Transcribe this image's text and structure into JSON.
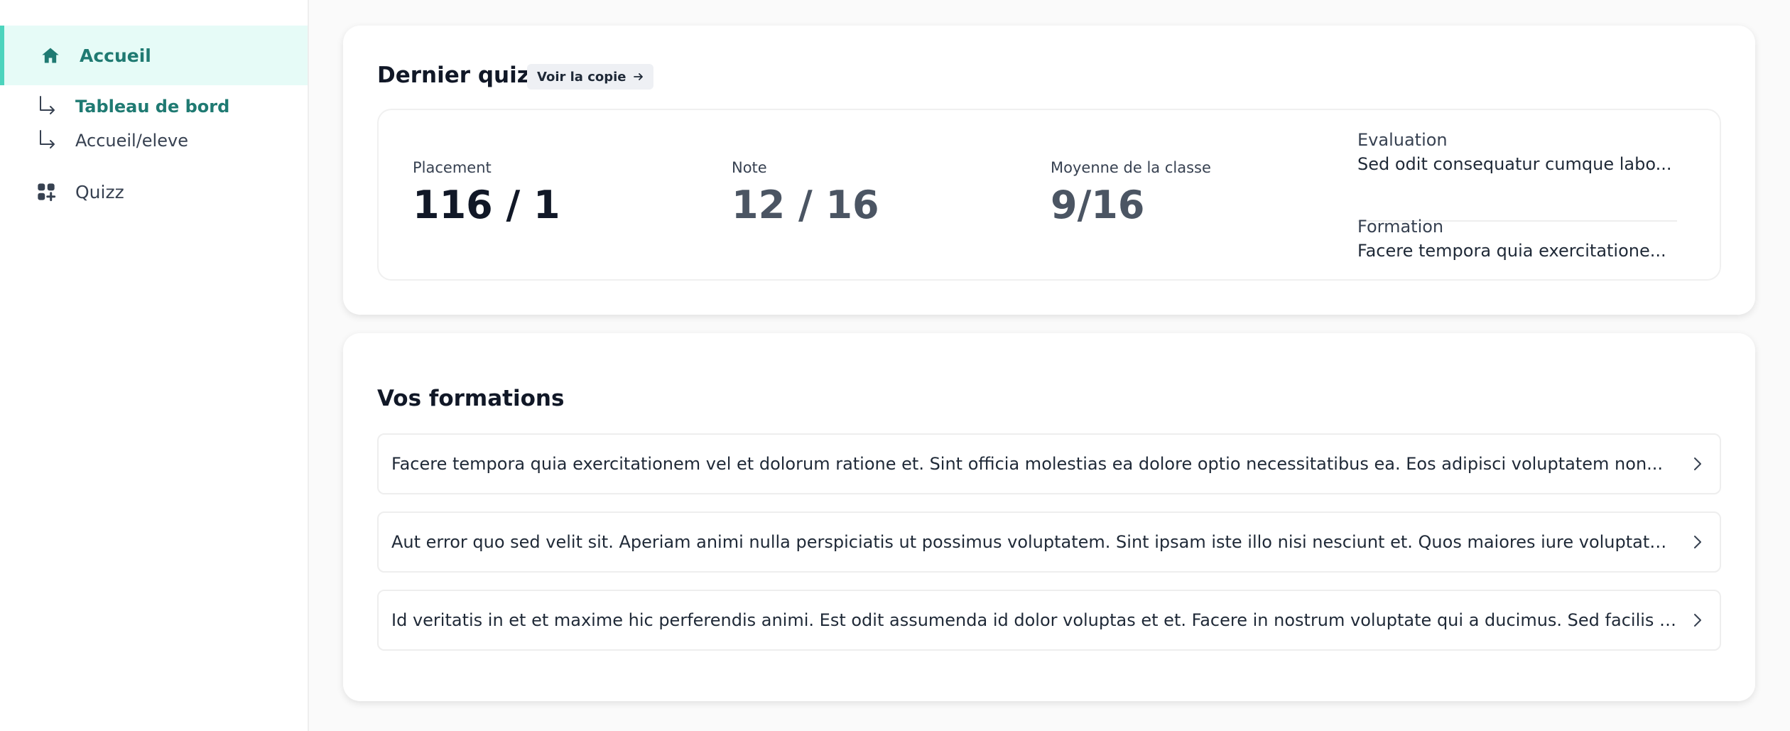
{
  "sidebar": {
    "items": [
      {
        "label": "Accueil",
        "icon": "home-icon",
        "active": true
      },
      {
        "label": "Tableau de bord",
        "icon": "subitem-arrow-icon",
        "current": true
      },
      {
        "label": "Accueil/eleve",
        "icon": "subitem-arrow-icon"
      },
      {
        "label": "Quizz",
        "icon": "grid-plus-icon"
      }
    ]
  },
  "last_quiz": {
    "title": "Dernier quiz",
    "view_copy_label": "Voir la copie",
    "view_copy_icon": "arrow-right-icon",
    "stats": [
      {
        "label": "Placement",
        "value": "116 / 1",
        "color": "#111827"
      },
      {
        "label": "Note",
        "value": "12 / 16",
        "color": "#4b5563"
      },
      {
        "label": "Moyenne de la classe",
        "value": "9/16",
        "color": "#4b5563"
      }
    ],
    "evaluation": {
      "label": "Evaluation",
      "text": "Sed odit consequatur cumque labo..."
    },
    "formation": {
      "label": "Formation",
      "text": "Facere tempora quia exercitatione..."
    }
  },
  "formations": {
    "title": "Vos formations",
    "items": [
      "Facere tempora quia exercitationem vel et dolorum ratione et. Sint officia molestias ea dolore optio necessitatibus ea. Eos adipisci voluptatem non...",
      "Aut error quo sed velit sit. Aperiam animi nulla perspiciatis ut possimus voluptatem. Sint ipsam iste illo nisi nesciunt et. Quos maiores iure voluptatum...",
      "Id veritatis in et et maxime hic perferendis animi. Est odit assumenda id dolor voluptas et et. Facere in nostrum voluptate qui a ducimus. Sed facilis qui..."
    ],
    "item_icon": "chevron-right-icon"
  },
  "colors": {
    "accent": "#1f7a72",
    "active_bg": "#e6fbf7",
    "active_border": "#4cd4bd"
  }
}
